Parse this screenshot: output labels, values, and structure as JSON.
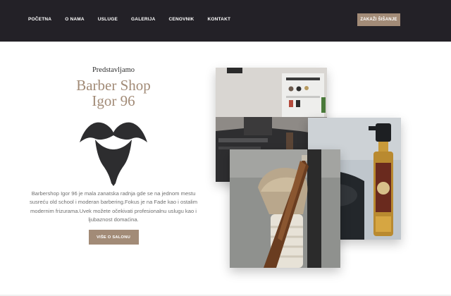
{
  "nav": {
    "items": [
      {
        "label": "POČETNA"
      },
      {
        "label": "O NAMA"
      },
      {
        "label": "USLUGE"
      },
      {
        "label": "GALERIJA"
      },
      {
        "label": "CENOVNIK"
      },
      {
        "label": "KONTAKT"
      }
    ],
    "cta_label": "ZAKAŽI ŠIŠANJE"
  },
  "intro": {
    "kicker": "Predstavljamo",
    "title_line1": "Barber Shop",
    "title_line2": "Igor 96",
    "logo_icon": "mustache-beard-icon",
    "description": "Barbershop Igor 96 je mala zanatska radnja gde se na jednom mestu susreću old school i moderan barbering.Fokus je na Fade kao i ostalim modernim frizurama.Uvek možete očekivati profesionalnu uslugu kao i ljubaznost domaćina.",
    "button_label": "VIŠE O SALONU"
  },
  "gallery": {
    "images": [
      "barber-station-photo",
      "spray-bottle-photo",
      "shaving-brush-razor-photo"
    ]
  },
  "colors": {
    "header_bg": "#232127",
    "accent": "#a28b77",
    "text": "#6f6f6f",
    "logo": "#2d2d2f"
  }
}
